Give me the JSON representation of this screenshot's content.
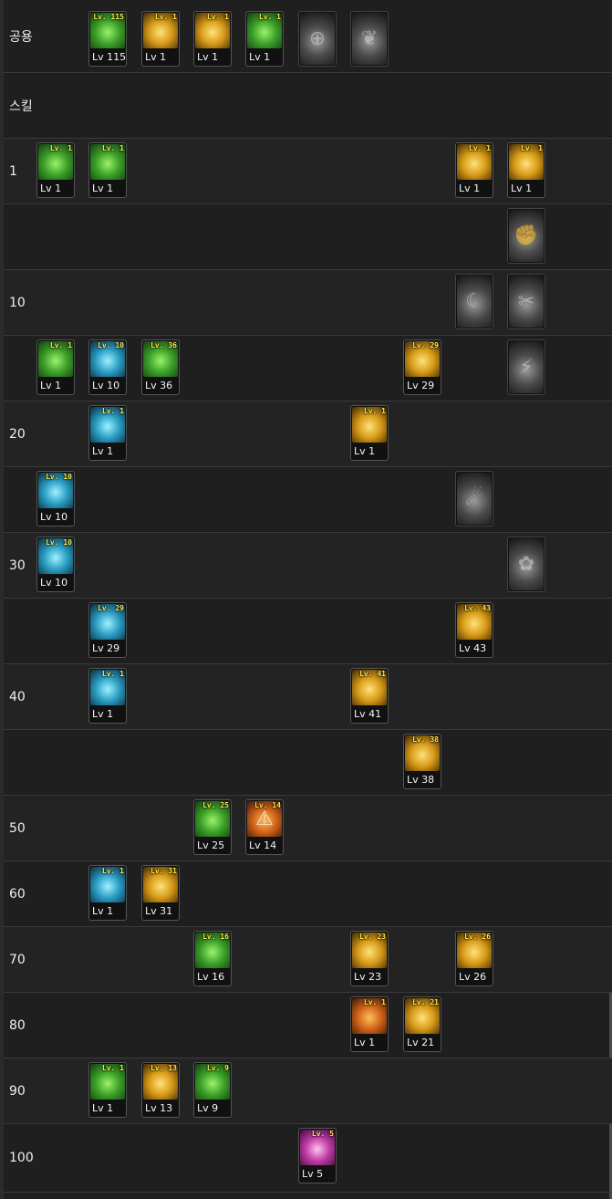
{
  "rows": [
    {
      "label": "공용"
    },
    {
      "label": "스킬"
    },
    {
      "label": "1"
    },
    {
      "label": ""
    },
    {
      "label": "10"
    },
    {
      "label": ""
    },
    {
      "label": "20"
    },
    {
      "label": ""
    },
    {
      "label": "30"
    },
    {
      "label": ""
    },
    {
      "label": "40"
    },
    {
      "label": ""
    },
    {
      "label": "50"
    },
    {
      "label": "60"
    },
    {
      "label": "70"
    },
    {
      "label": "80"
    },
    {
      "label": "90"
    },
    {
      "label": "100"
    }
  ],
  "skills": [
    {
      "badge": "Lv. 115",
      "lv": "Lv 115",
      "color": "green"
    },
    {
      "badge": "Lv. 1",
      "lv": "Lv 1",
      "color": "gold"
    },
    {
      "badge": "Lv. 1",
      "lv": "Lv 1",
      "color": "gold"
    },
    {
      "badge": "Lv. 1",
      "lv": "Lv 1",
      "color": "green"
    },
    {
      "badge": "",
      "lv": "",
      "color": "gray",
      "icon": "crosshair-icon"
    },
    {
      "badge": "",
      "lv": "",
      "color": "gray",
      "icon": "wings-icon"
    },
    {
      "badge": "Lv. 1",
      "lv": "Lv 1",
      "color": "green"
    },
    {
      "badge": "Lv. 1",
      "lv": "Lv 1",
      "color": "green"
    },
    {
      "badge": "Lv. 1",
      "lv": "Lv 1",
      "color": "gold"
    },
    {
      "badge": "Lv. 1",
      "lv": "Lv 1",
      "color": "gold"
    },
    {
      "badge": "",
      "lv": "",
      "color": "gray",
      "icon": "strike-icon"
    },
    {
      "badge": "",
      "lv": "",
      "color": "gray",
      "icon": "claw-icon"
    },
    {
      "badge": "",
      "lv": "",
      "color": "gray",
      "icon": "blades-icon"
    },
    {
      "badge": "Lv. 1",
      "lv": "Lv 1",
      "color": "green"
    },
    {
      "badge": "Lv. 10",
      "lv": "Lv 10",
      "color": "cyan"
    },
    {
      "badge": "Lv. 36",
      "lv": "Lv 36",
      "color": "green"
    },
    {
      "badge": "Lv. 29",
      "lv": "Lv 29",
      "color": "gold"
    },
    {
      "badge": "",
      "lv": "",
      "color": "gray",
      "icon": "kick-icon"
    },
    {
      "badge": "Lv. 1",
      "lv": "Lv 1",
      "color": "cyan"
    },
    {
      "badge": "Lv. 1",
      "lv": "Lv 1",
      "color": "gold"
    },
    {
      "badge": "Lv. 10",
      "lv": "Lv 10",
      "color": "cyan"
    },
    {
      "badge": "",
      "lv": "",
      "color": "gray",
      "icon": "slash-icon"
    },
    {
      "badge": "Lv. 10",
      "lv": "Lv 10",
      "color": "cyan"
    },
    {
      "badge": "",
      "lv": "",
      "color": "gray",
      "icon": "revolver-icon"
    },
    {
      "badge": "Lv. 29",
      "lv": "Lv 29",
      "color": "cyan"
    },
    {
      "badge": "Lv. 43",
      "lv": "Lv 43",
      "color": "gold"
    },
    {
      "badge": "Lv. 1",
      "lv": "Lv 1",
      "color": "cyan"
    },
    {
      "badge": "Lv. 41",
      "lv": "Lv 41",
      "color": "gold"
    },
    {
      "badge": "Lv. 38",
      "lv": "Lv 38",
      "color": "gold"
    },
    {
      "badge": "Lv. 25",
      "lv": "Lv 25",
      "color": "green"
    },
    {
      "badge": "Lv. 14",
      "lv": "Lv 14",
      "color": "orange",
      "icon": "warning-icon"
    },
    {
      "badge": "Lv. 1",
      "lv": "Lv 1",
      "color": "cyan"
    },
    {
      "badge": "Lv. 31",
      "lv": "Lv 31",
      "color": "gold"
    },
    {
      "badge": "Lv. 16",
      "lv": "Lv 16",
      "color": "green"
    },
    {
      "badge": "Lv. 23",
      "lv": "Lv 23",
      "color": "gold"
    },
    {
      "badge": "Lv. 26",
      "lv": "Lv 26",
      "color": "gold"
    },
    {
      "badge": "Lv. 1",
      "lv": "Lv 1",
      "color": "orange"
    },
    {
      "badge": "Lv. 21",
      "lv": "Lv 21",
      "color": "gold"
    },
    {
      "badge": "Lv. 1",
      "lv": "Lv 1",
      "color": "green"
    },
    {
      "badge": "Lv. 13",
      "lv": "Lv 13",
      "color": "gold"
    },
    {
      "badge": "Lv. 9",
      "lv": "Lv 9",
      "color": "green"
    },
    {
      "badge": "Lv. 5",
      "lv": "Lv 5",
      "color": "pink"
    }
  ]
}
